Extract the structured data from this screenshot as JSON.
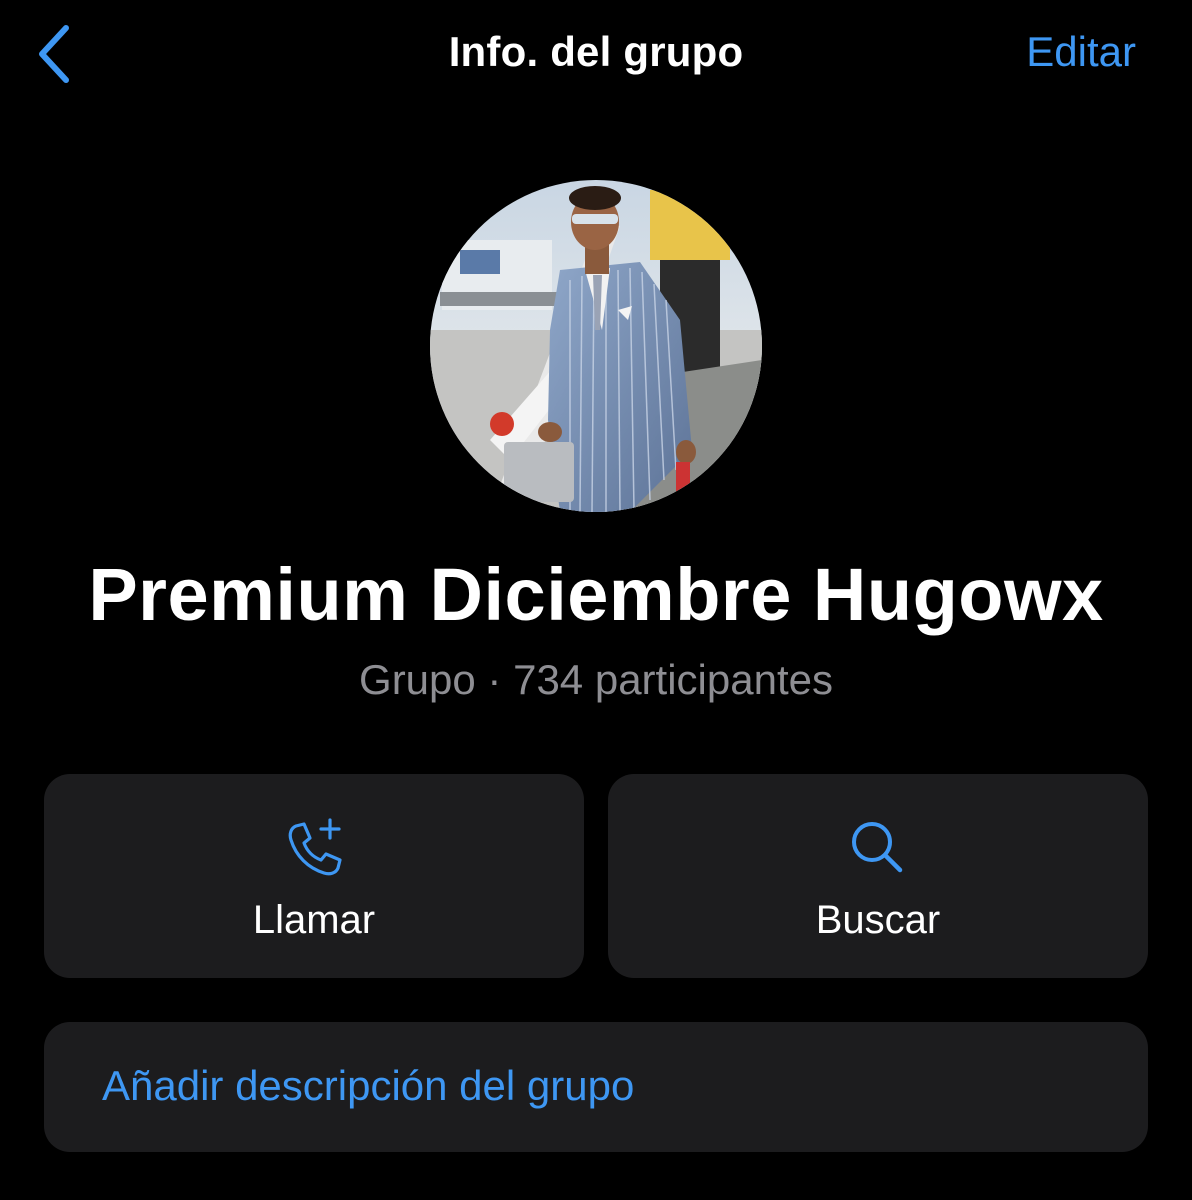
{
  "nav": {
    "back_icon": "chevron-left-icon",
    "title": "Info. del grupo",
    "edit_label": "Editar",
    "accent_color": "#3e97f3"
  },
  "group": {
    "avatar": "group-photo",
    "name": "Premium Diciembre Hugowx",
    "subtitle": "Grupo · 734 participantes"
  },
  "actions": [
    {
      "label": "Llamar",
      "icon": "phone-plus-icon"
    },
    {
      "label": "Buscar",
      "icon": "search-icon"
    }
  ],
  "description": {
    "add_label": "Añadir descripción del grupo"
  }
}
